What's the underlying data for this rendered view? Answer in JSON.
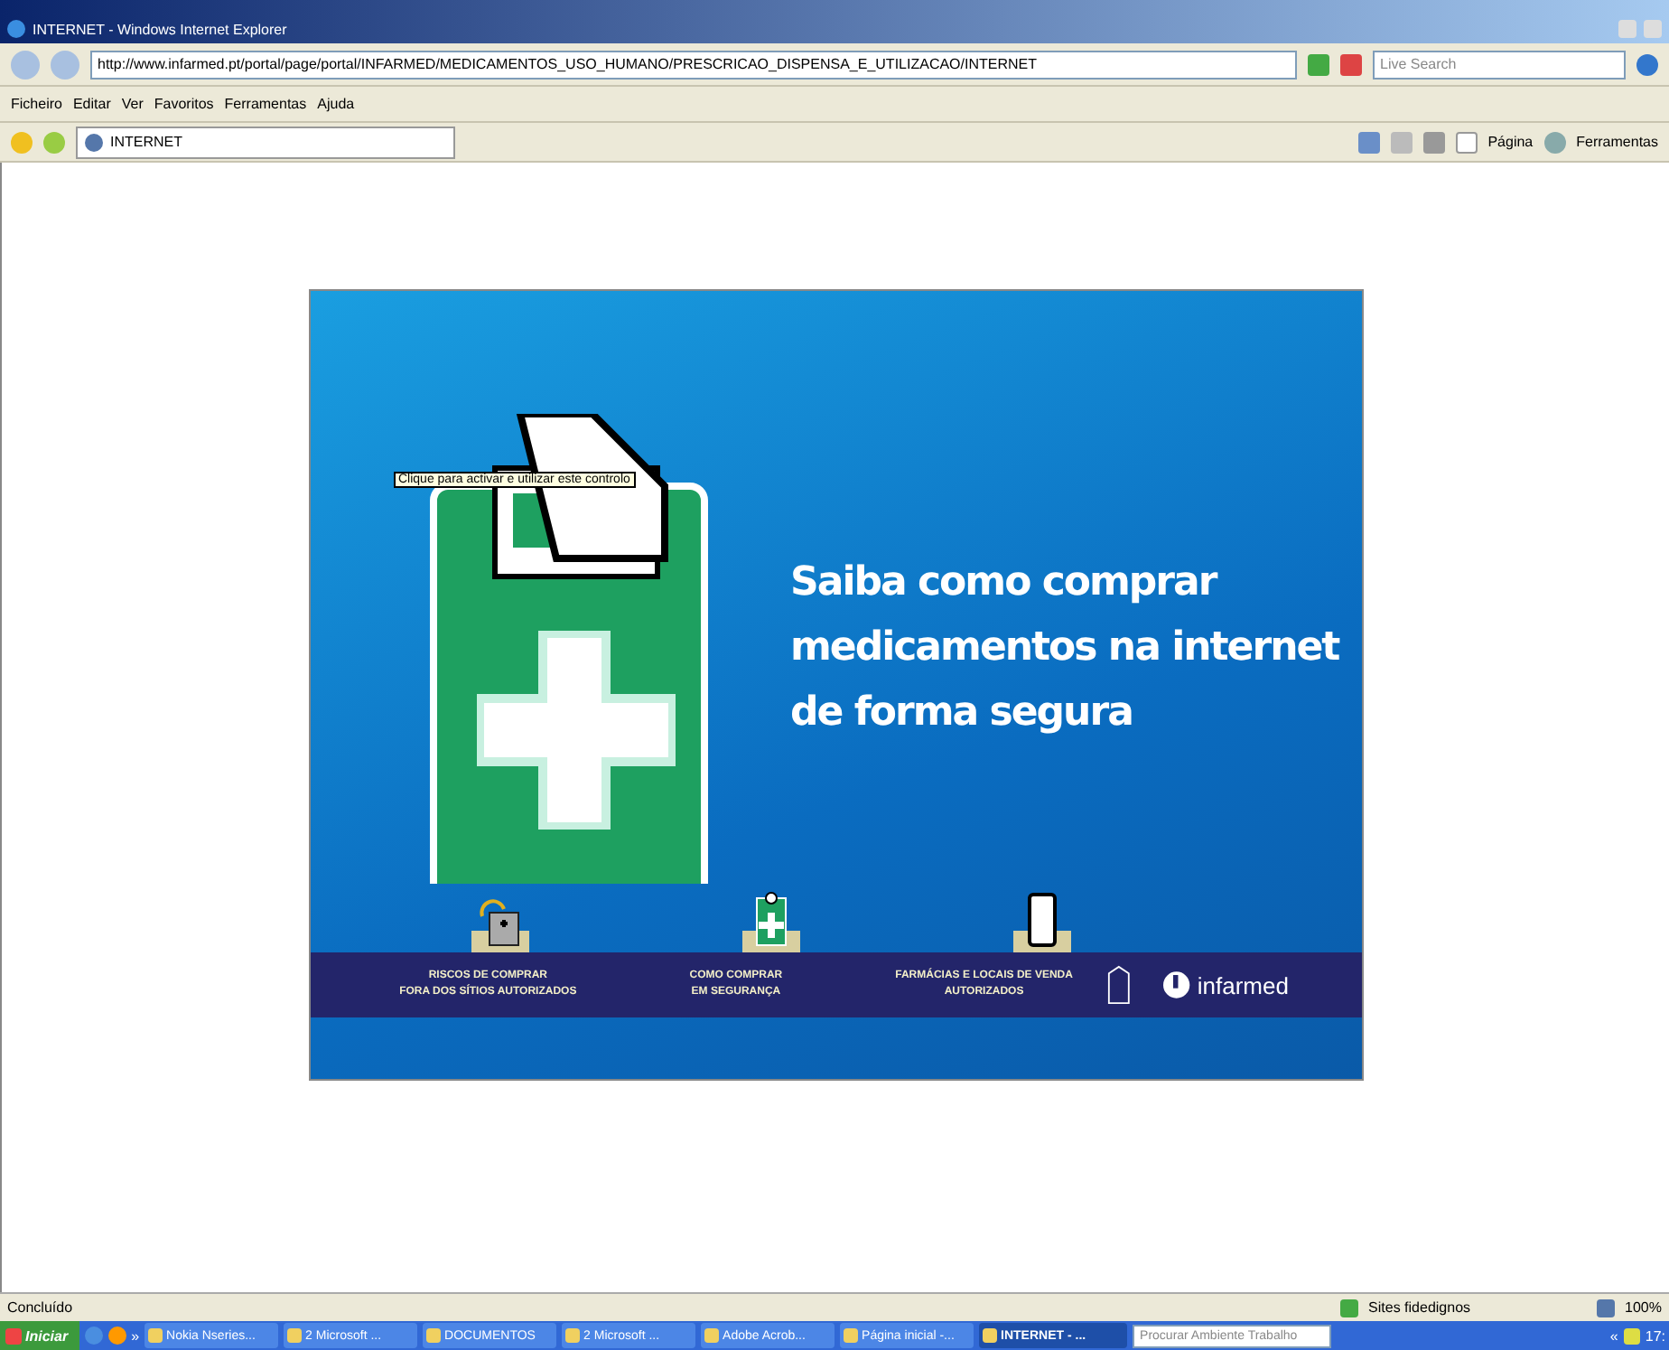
{
  "window": {
    "title": "INTERNET - Windows Internet Explorer"
  },
  "address": {
    "url": "http://www.infarmed.pt/portal/page/portal/INFARMED/MEDICAMENTOS_USO_HUMANO/PRESCRICAO_DISPENSA_E_UTILIZACAO/INTERNET"
  },
  "search": {
    "placeholder": "Live Search"
  },
  "menu": [
    "Ficheiro",
    "Editar",
    "Ver",
    "Favoritos",
    "Ferramentas",
    "Ajuda"
  ],
  "tabs": [
    {
      "label": "INTERNET",
      "selected": true
    }
  ],
  "command_bar": [
    {
      "kind": "home"
    },
    {
      "kind": "feeds"
    },
    {
      "kind": "print"
    },
    {
      "kind": "page",
      "label": "Página"
    },
    {
      "kind": "tools",
      "label": "Ferramentas"
    }
  ],
  "banner": {
    "headline": [
      "Saiba como comprar",
      "medicamentos na internet",
      "de forma segura"
    ],
    "links": [
      {
        "kind": "lock",
        "lines": [
          "RISCOS DE COMPRAR",
          "FORA DOS SÍTIOS AUTORIZADOS"
        ]
      },
      {
        "kind": "clipboard",
        "lines": [
          "COMO COMPRAR",
          "EM SEGURANÇA"
        ]
      },
      {
        "kind": "phone",
        "lines": [
          "FARMÁCIAS E LOCAIS DE VENDA",
          "AUTORIZADOS"
        ]
      }
    ],
    "logo": "infarmed"
  },
  "tooltip": "Clique para activar e utilizar este controlo",
  "status_bar": {
    "text": "Concluído",
    "zone": "Sites fidedignos",
    "zoom": "100%"
  },
  "taskbar": {
    "start": "Iniciar",
    "overflow": "»",
    "buttons": [
      {
        "label": "Nokia Nseries...",
        "selected": false
      },
      {
        "label": "2 Microsoft ...",
        "selected": false
      },
      {
        "label": "DOCUMENTOS",
        "selected": false
      },
      {
        "label": "2 Microsoft ...",
        "selected": false
      },
      {
        "label": "Adobe Acrob...",
        "selected": false
      },
      {
        "label": "Página inicial -...",
        "selected": false
      },
      {
        "label": "INTERNET - ...",
        "selected": true
      }
    ],
    "search_placeholder": "Procurar Ambiente Trabalho",
    "tray_overflow": "«",
    "clock": "17:"
  }
}
